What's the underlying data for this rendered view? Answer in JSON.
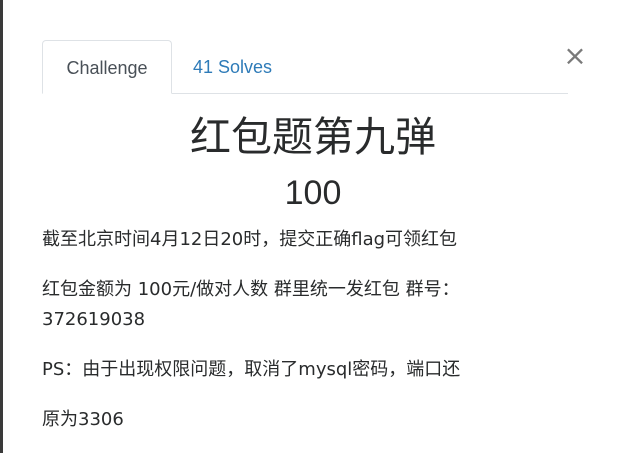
{
  "tabs": {
    "challenge": "Challenge",
    "solves": "41 Solves"
  },
  "close_glyph": "×",
  "challenge": {
    "name": "红包题第九弹",
    "value": "100",
    "description": [
      "截至北京时间4月12日20时，提交正确flag可领红包",
      "红包金额为 100元/做对人数 群里统一发红包 群号：",
      "372619038",
      "PS：由于出现权限问题，取消了mysql密码，端口还",
      "原为3306"
    ]
  },
  "colors": {
    "link": "#2e7bb8",
    "text": "#292b2c",
    "border": "#dee2e6",
    "close": "#7a7a7a"
  }
}
